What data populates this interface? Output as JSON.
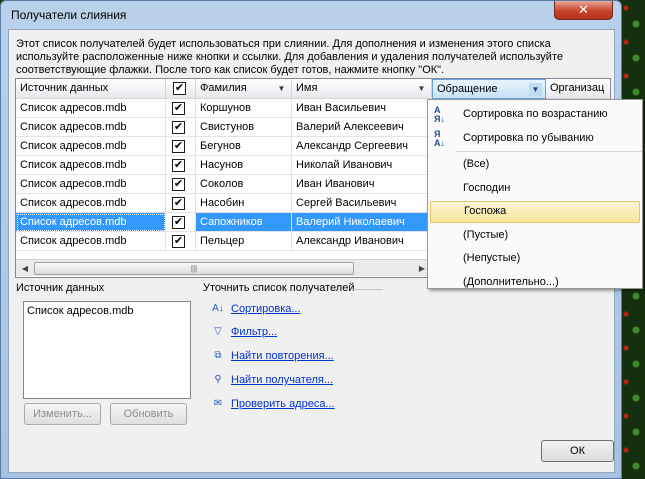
{
  "window": {
    "title": "Получатели слияния",
    "close_glyph": "✕"
  },
  "intro_text": "Этот список получателей будет использоваться при слиянии. Для дополнения и изменения этого списка используйте расположенные ниже кнопки и ссылки. Для добавления и удаления получателей используйте соответствующие флажки. После того как список будет готов, нажмите кнопку \"ОК\".",
  "grid": {
    "columns": [
      "Источник данных",
      "✔",
      "Фамилия",
      "Имя",
      "Обращение",
      "Организац"
    ],
    "rows": [
      {
        "source": "Список адресов.mdb",
        "checked": "✔",
        "surname": "Коршунов",
        "name": "Иван Васильевич"
      },
      {
        "source": "Список адресов.mdb",
        "checked": "✔",
        "surname": "Свистунов",
        "name": "Валерий Алексеевич"
      },
      {
        "source": "Список адресов.mdb",
        "checked": "✔",
        "surname": "Бегунов",
        "name": "Александр Сергеевич"
      },
      {
        "source": "Список адресов.mdb",
        "checked": "✔",
        "surname": "Насунов",
        "name": "Николай Иванович"
      },
      {
        "source": "Список адресов.mdb",
        "checked": "✔",
        "surname": "Соколов",
        "name": "Иван Иванович"
      },
      {
        "source": "Список адресов.mdb",
        "checked": "✔",
        "surname": "Насобин",
        "name": "Сергей Васильевич"
      },
      {
        "source": "Список адресов.mdb",
        "checked": "✔",
        "surname": "Сапожников",
        "name": "Валерий Николаевич",
        "selected": true
      },
      {
        "source": "Список адресов.mdb",
        "checked": "✔",
        "surname": "Пельцер",
        "name": "Александр Иванович"
      }
    ]
  },
  "dropdown": {
    "sort_asc": "Сортировка по возрастанию",
    "sort_desc": "Сортировка по убыванию",
    "filters": [
      "(Все)",
      "Господин",
      "Госпожа",
      "(Пустые)",
      "(Непустые)",
      "(Дополнительно...)"
    ],
    "hovered": "Госпожа"
  },
  "data_sources": {
    "label": "Источник данных",
    "items": [
      "Список адресов.mdb"
    ]
  },
  "refine": {
    "label": "Уточнить список получателей",
    "links": [
      "Сортировка...",
      "Фильтр...",
      "Найти повторения...",
      "Найти получателя...",
      "Проверить адреса..."
    ]
  },
  "buttons": {
    "edit": "Изменить...",
    "refresh": "Обновить",
    "ok": "ОК"
  }
}
